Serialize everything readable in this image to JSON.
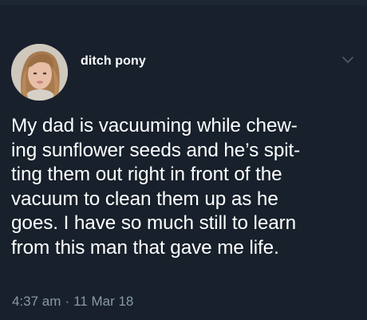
{
  "tweet": {
    "author_name": "ditch pony",
    "text_lines": [
      "My dad is vacuuming while chew-",
      "ing sunflower seeds and he’s spit-",
      "ting them out right in front of the",
      "vacuum to clean them up as he",
      "goes. I have so much still to learn",
      "from this man that gave me life."
    ],
    "time": "4:37 am",
    "separator": "·",
    "date": "11 Mar 18"
  },
  "icons": {
    "avatar": "user-profile-photo",
    "menu": "chevron-down-icon"
  },
  "colors": {
    "background": "#17202b",
    "text_primary": "#ffffff",
    "text_secondary": "#8899a6"
  }
}
